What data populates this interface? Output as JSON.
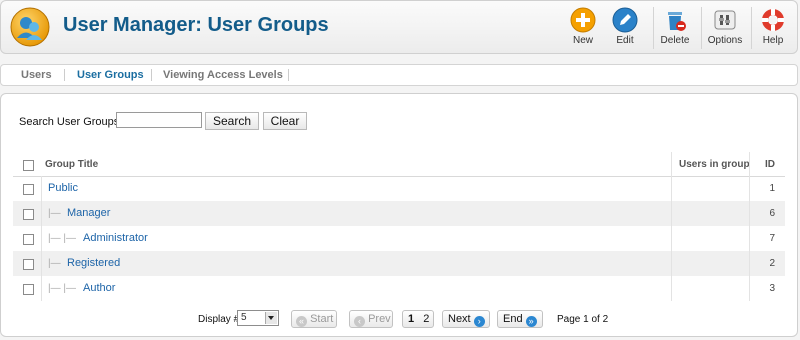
{
  "header": {
    "title": "User Manager: User Groups",
    "toolbar": {
      "new": "New",
      "edit": "Edit",
      "delete": "Delete",
      "options": "Options",
      "help": "Help"
    }
  },
  "tabs": [
    "Users",
    "User Groups",
    "Viewing Access Levels"
  ],
  "active_tab": "User Groups",
  "search": {
    "label": "Search User Groups",
    "value": "",
    "search_button": "Search",
    "clear_button": "Clear"
  },
  "table": {
    "columns": {
      "title": "Group Title",
      "users": "Users in group",
      "id": "ID"
    },
    "rows": [
      {
        "title": "Public",
        "tree": "",
        "users": "",
        "id": "1"
      },
      {
        "title": "Manager",
        "tree": "|— ",
        "users": "",
        "id": "6"
      },
      {
        "title": "Administrator",
        "tree": "|— |— ",
        "users": "",
        "id": "7"
      },
      {
        "title": "Registered",
        "tree": "|— ",
        "users": "",
        "id": "2"
      },
      {
        "title": "Author",
        "tree": "|— |— ",
        "users": "",
        "id": "3"
      }
    ]
  },
  "pagination": {
    "display_label": "Display #",
    "display_value": "5",
    "start": "Start",
    "prev": "Prev",
    "pages": [
      "1",
      "2"
    ],
    "next": "Next",
    "end": "End",
    "page_info": "Page 1 of 2"
  },
  "colors": {
    "title": "#135c8a",
    "link": "#1d64a8",
    "row_alt": "#f0f0f0"
  }
}
